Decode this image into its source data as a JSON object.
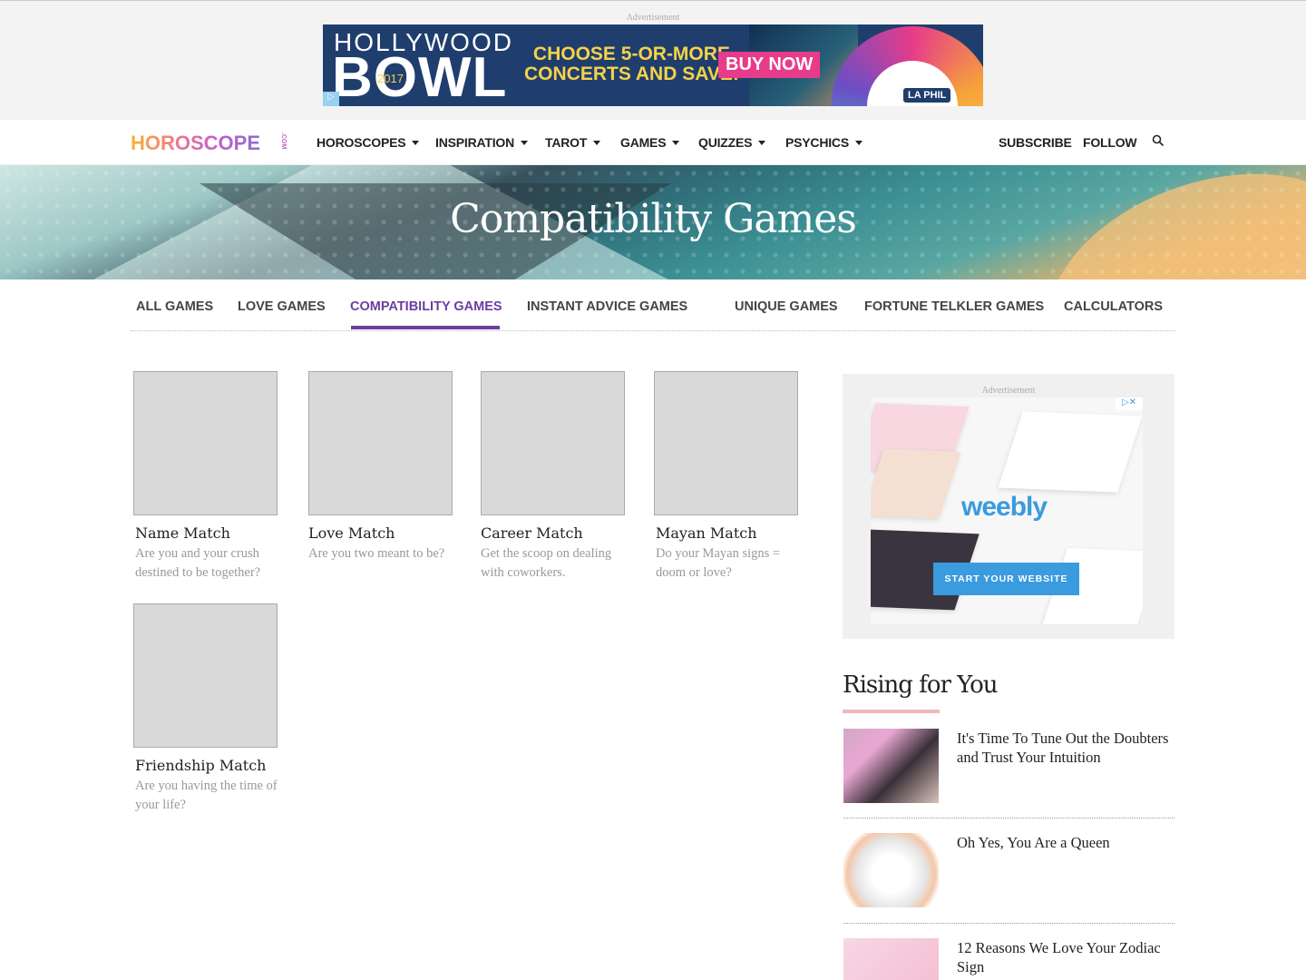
{
  "top_ad": {
    "label": "Advertisement",
    "line1": "HOLLYWOOD",
    "line2": "BOWL",
    "year": "2017",
    "copy_line1": "CHOOSE 5-OR-MORE",
    "copy_line2": "CONCERTS AND SAVE!",
    "cta": "BUY NOW",
    "sponsor": "LA PHIL"
  },
  "nav": {
    "logo": "HOROSCOPE",
    "logo_suffix": ".COM",
    "items": [
      {
        "label": "HOROSCOPES"
      },
      {
        "label": "INSPIRATION"
      },
      {
        "label": "TAROT"
      },
      {
        "label": "GAMES"
      },
      {
        "label": "QUIZZES"
      },
      {
        "label": "PSYCHICS"
      }
    ],
    "subscribe": "SUBSCRIBE",
    "follow": "FOLLOW"
  },
  "hero": {
    "title": "Compatibility Games"
  },
  "tabs": [
    {
      "label": "ALL GAMES"
    },
    {
      "label": "LOVE GAMES"
    },
    {
      "label": "COMPATIBILITY GAMES",
      "active": true
    },
    {
      "label": "INSTANT ADVICE GAMES"
    },
    {
      "label": "UNIQUE GAMES"
    },
    {
      "label": "FORTUNE TELKLER GAMES"
    },
    {
      "label": "CALCULATORS"
    }
  ],
  "games": [
    {
      "title": "Name Match",
      "desc": "Are you and your crush destined to be together?"
    },
    {
      "title": "Love Match",
      "desc": "Are you two meant to be?"
    },
    {
      "title": "Career Match",
      "desc": "Get the scoop on dealing with coworkers."
    },
    {
      "title": "Mayan Match",
      "desc": "Do your Mayan signs = doom or love?"
    },
    {
      "title": "Friendship Match",
      "desc": "Are you having the time of your life?"
    }
  ],
  "side_ad": {
    "label": "Advertisement",
    "brand": "weebly",
    "cta": "START YOUR WEBSITE"
  },
  "rising": {
    "title": "Rising for You",
    "stories": [
      {
        "title": "It's Time To Tune Out the Doubters and Trust Your Intuition"
      },
      {
        "title": "Oh Yes, You Are a Queen"
      },
      {
        "title": "12 Reasons We Love Your Zodiac Sign"
      }
    ]
  },
  "colors": {
    "accent": "#6a3fa0",
    "ad_blue": "#3a9bde",
    "rising_bar": "#f2b7b7"
  }
}
